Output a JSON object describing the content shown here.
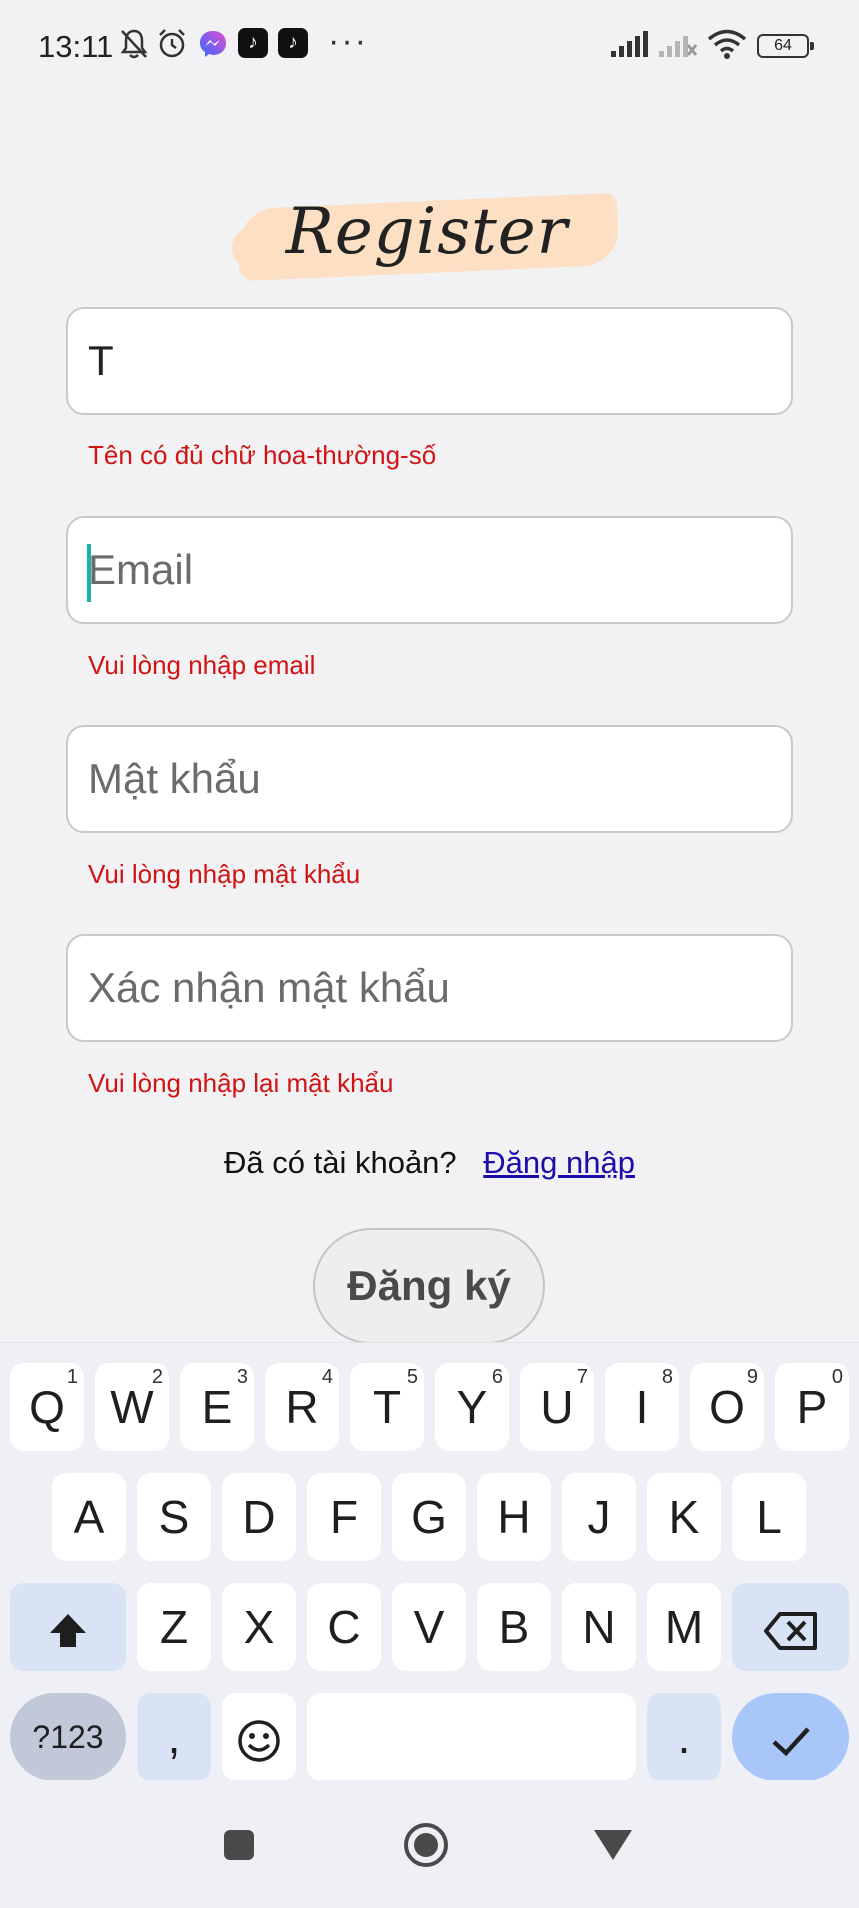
{
  "status_bar": {
    "time": "13:11",
    "more": "···",
    "battery": "64",
    "icons": [
      "mute-bell-icon",
      "alarm-icon",
      "messenger-icon",
      "tiktok-icon",
      "tiktok-icon",
      "signal-icon",
      "signal-no-service-icon",
      "wifi-icon",
      "battery-icon"
    ]
  },
  "header": {
    "title": "Register",
    "accent_color": "#fde0c3"
  },
  "form": {
    "name": {
      "value": "T",
      "placeholder": "",
      "error": "Tên có đủ chữ hoa-thường-số"
    },
    "email": {
      "value": "",
      "placeholder": "Email",
      "error": "Vui lòng nhập email"
    },
    "password": {
      "value": "",
      "placeholder": "Mật khẩu",
      "error": "Vui lòng nhập mật khẩu"
    },
    "confirm_password": {
      "value": "",
      "placeholder": "Xác nhận mật khẩu",
      "error": "Vui lòng nhập lại mật khẩu"
    },
    "error_color": "#d01414"
  },
  "login": {
    "prompt": "Đã có tài khoản?",
    "link": "Đăng nhập"
  },
  "register_button": {
    "label": "Đăng ký"
  },
  "keyboard": {
    "row1": [
      {
        "label": "Q",
        "hint": "1"
      },
      {
        "label": "W",
        "hint": "2"
      },
      {
        "label": "E",
        "hint": "3"
      },
      {
        "label": "R",
        "hint": "4"
      },
      {
        "label": "T",
        "hint": "5"
      },
      {
        "label": "Y",
        "hint": "6"
      },
      {
        "label": "U",
        "hint": "7"
      },
      {
        "label": "I",
        "hint": "8"
      },
      {
        "label": "O",
        "hint": "9"
      },
      {
        "label": "P",
        "hint": "0"
      }
    ],
    "row2": [
      "A",
      "S",
      "D",
      "F",
      "G",
      "H",
      "J",
      "K",
      "L"
    ],
    "row3": [
      "Z",
      "X",
      "C",
      "V",
      "B",
      "N",
      "M"
    ],
    "symbols": "?123",
    "comma": ",",
    "period": ".",
    "accent_color": "#a8c6fa"
  },
  "nav_bar": {
    "icons": [
      "recents-icon",
      "home-icon",
      "back-icon"
    ]
  }
}
